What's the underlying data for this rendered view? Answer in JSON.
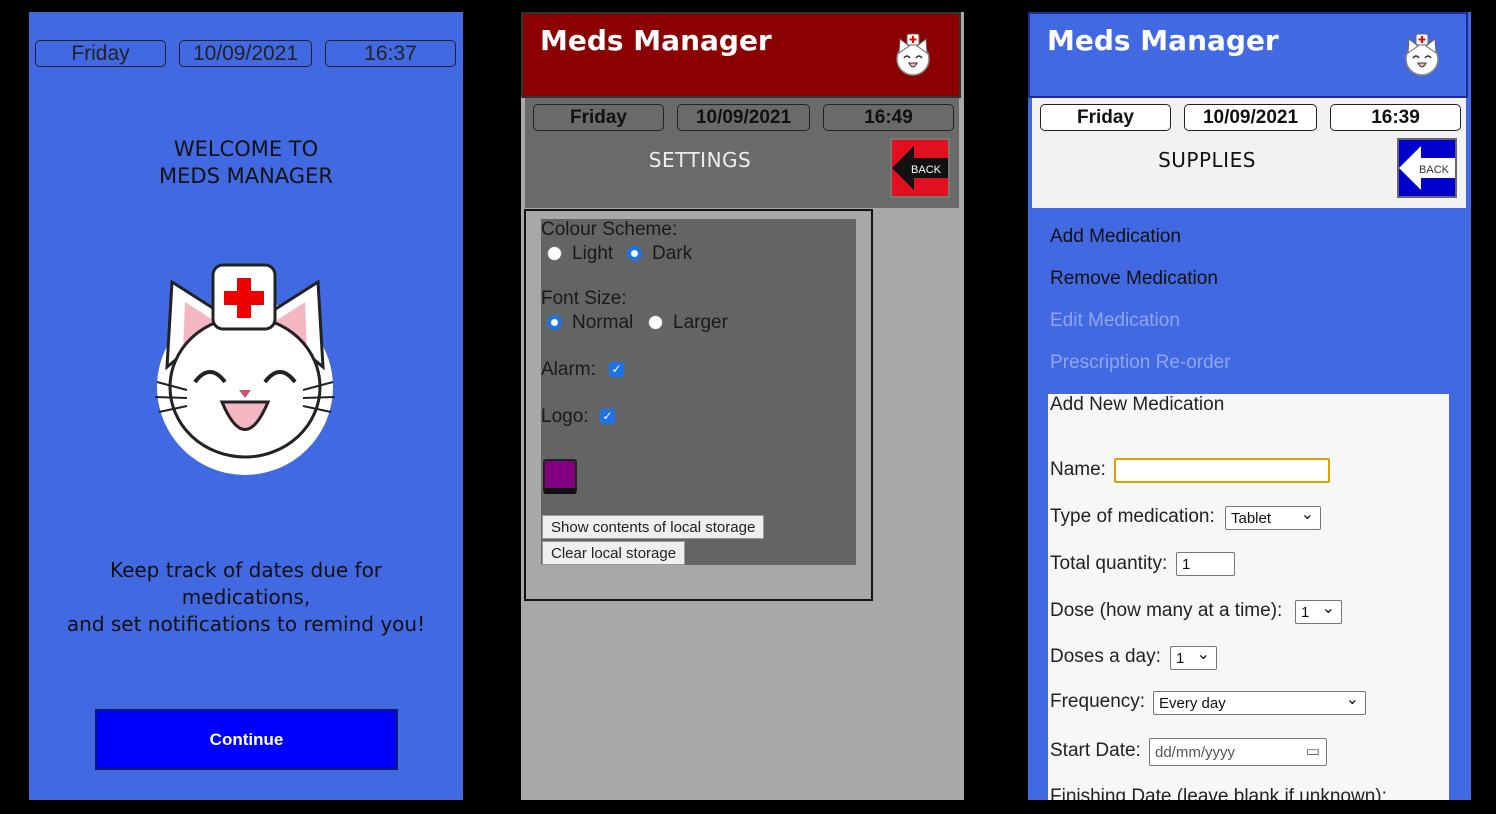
{
  "welcome_screen": {
    "day": "Friday",
    "date": "10/09/2021",
    "time": "16:37",
    "welcome_line1": "WELCOME TO",
    "welcome_line2": "MEDS MANAGER",
    "tagline_line1": "Keep track of dates due for",
    "tagline_line2": "medications,",
    "tagline_line3": "and set notifications to remind you!",
    "continue_label": "Continue"
  },
  "settings_screen": {
    "app_name": "Meds Manager",
    "day": "Friday",
    "date": "10/09/2021",
    "time": "16:49",
    "section_title": "SETTINGS",
    "back_label": "BACK",
    "colour_scheme_label": "Colour Scheme:",
    "light_label": "Light",
    "dark_label": "Dark",
    "font_size_label": "Font Size:",
    "normal_label": "Normal",
    "larger_label": "Larger",
    "alarm_label": "Alarm:",
    "logo_label": "Logo:",
    "show_storage_label": "Show contents of local storage",
    "clear_storage_label": "Clear local storage",
    "colors": {
      "header": "#8b0000",
      "swatch": "#800080"
    }
  },
  "supplies_screen": {
    "app_name": "Meds Manager",
    "day": "Friday",
    "date": "10/09/2021",
    "time": "16:39",
    "section_title": "SUPPLIES",
    "back_label": "BACK",
    "menu": {
      "add": "Add Medication",
      "remove": "Remove Medication",
      "edit": "Edit Medication",
      "reorder": "Prescription Re-order"
    },
    "form": {
      "title": "Add New Medication",
      "name_label": "Name:",
      "name_value": "",
      "type_label": "Type of medication:",
      "type_value": "Tablet",
      "total_label": "Total quantity:",
      "total_value": "1",
      "dose_label": "Dose (how many at a time):",
      "dose_value": "1",
      "doses_day_label": "Doses a day:",
      "doses_day_value": "1",
      "frequency_label": "Frequency:",
      "frequency_value": "Every day",
      "start_label": "Start Date:",
      "start_placeholder": "dd/mm/yyyy",
      "finish_label": "Finishing Date (leave blank if unknown):"
    },
    "colors": {
      "header": "#4169e1",
      "back": "#0000cc"
    }
  }
}
